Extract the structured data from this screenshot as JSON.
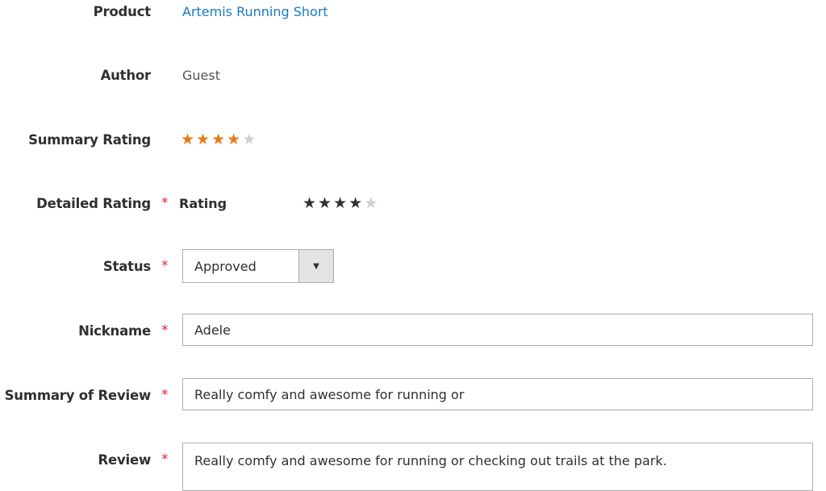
{
  "product": {
    "label": "Product",
    "value": "Artemis Running Short"
  },
  "author": {
    "label": "Author",
    "value": "Guest"
  },
  "summary_rating": {
    "label": "Summary Rating",
    "stars": 4,
    "max": 5,
    "color": "#eb7a14"
  },
  "detailed_rating": {
    "label": "Detailed Rating",
    "sub_label": "Rating",
    "stars": 4,
    "max": 5,
    "color": "#333333"
  },
  "status": {
    "label": "Status",
    "value": "Approved"
  },
  "nickname": {
    "label": "Nickname",
    "value": "Adele"
  },
  "summary": {
    "label": "Summary of Review",
    "value": "Really comfy and awesome for running or"
  },
  "review": {
    "label": "Review",
    "value": "Really comfy and awesome for running or checking out trails at the park."
  },
  "required_mark": "*"
}
